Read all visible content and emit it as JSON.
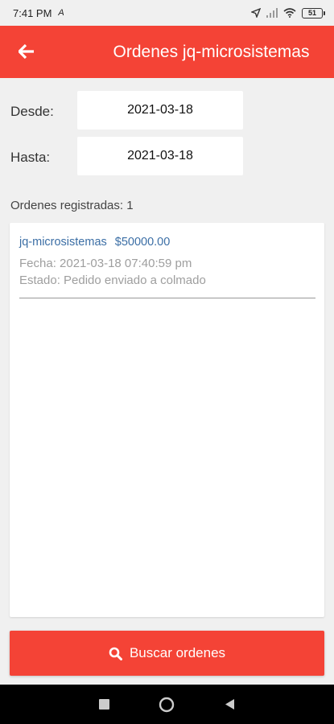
{
  "status_bar": {
    "time": "7:41 PM",
    "battery": "51"
  },
  "app_bar": {
    "title": "Ordenes jq-microsistemas"
  },
  "filters": {
    "from_label": "Desde:",
    "from_value": "2021-03-18",
    "to_label": "Hasta:",
    "to_value": "2021-03-18"
  },
  "orders": {
    "count_text": "Ordenes registradas: 1",
    "items": [
      {
        "store": "jq-microsistemas",
        "amount": "$50000.00",
        "date": "Fecha: 2021-03-18 07:40:59 pm",
        "status": "Estado: Pedido enviado a colmado"
      }
    ]
  },
  "search_button": {
    "label": "Buscar ordenes"
  },
  "colors": {
    "accent": "#f44336",
    "link": "#3b6ea5",
    "muted": "#9e9e9e"
  },
  "icons": {
    "back": "arrow-left-icon",
    "search": "search-icon",
    "nav_recent": "square-icon",
    "nav_home": "circle-icon",
    "nav_back": "triangle-back-icon"
  }
}
